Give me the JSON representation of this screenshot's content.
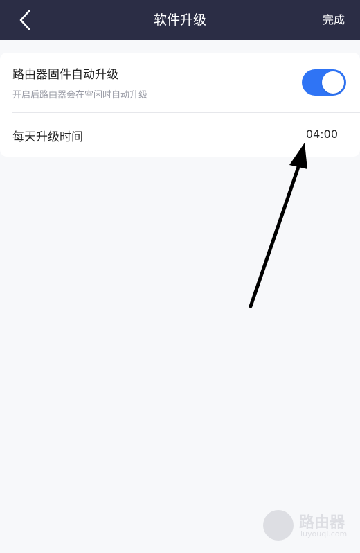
{
  "nav": {
    "title": "软件升级",
    "done_label": "完成",
    "back_icon": "chevron-left-icon"
  },
  "settings": {
    "auto_upgrade": {
      "title": "路由器固件自动升级",
      "description": "开启后路由器会在空闲时自动升级",
      "enabled": true
    },
    "daily_time": {
      "label": "每天升级时间",
      "value": "04:00"
    }
  },
  "watermark": {
    "title": "路由器",
    "subtitle": "luyouqi.com"
  },
  "colors": {
    "navbar": "#2b2d45",
    "toggle_on": "#2f74f5",
    "background": "#f7f8fa"
  }
}
